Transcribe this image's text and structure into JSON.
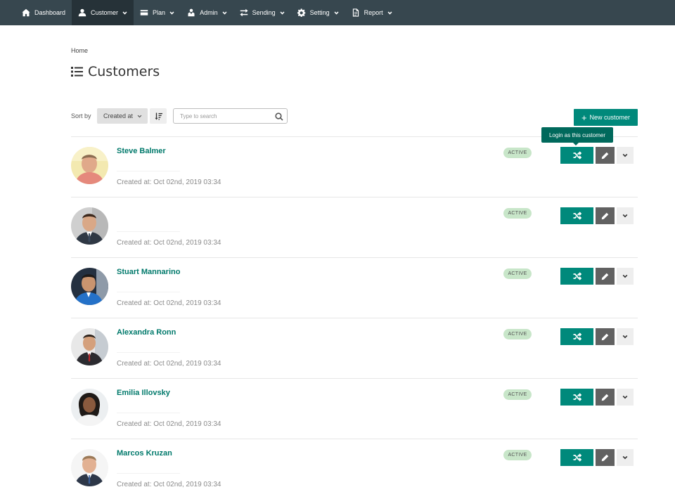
{
  "nav": {
    "items": [
      {
        "label": "Dashboard",
        "icon": "home-icon"
      },
      {
        "label": "Customer",
        "icon": "user-icon"
      },
      {
        "label": "Plan",
        "icon": "credit-card-icon"
      },
      {
        "label": "Admin",
        "icon": "admin-user-icon"
      },
      {
        "label": "Sending",
        "icon": "exchange-icon"
      },
      {
        "label": "Setting",
        "icon": "gear-icon"
      },
      {
        "label": "Report",
        "icon": "file-icon"
      }
    ],
    "active": "Customer"
  },
  "breadcrumb": "Home",
  "page": {
    "title": "Customers",
    "title_icon": "list-icon"
  },
  "toolbar": {
    "sort_label": "Sort by",
    "sort_value": "Created at",
    "search_placeholder": "Type to search",
    "new_button_label": "New customer"
  },
  "tooltip": "Login as this customer",
  "customers": [
    {
      "name": "Steve Balmer",
      "created": "Created at: Oct 02nd, 2019 03:34",
      "status": "ACTIVE"
    },
    {
      "name": "",
      "created": "Created at: Oct 02nd, 2019 03:34",
      "status": "ACTIVE"
    },
    {
      "name": "Stuart Mannarino",
      "created": "Created at: Oct 02nd, 2019 03:34",
      "status": "ACTIVE"
    },
    {
      "name": "Alexandra Ronn",
      "created": "Created at: Oct 02nd, 2019 03:34",
      "status": "ACTIVE"
    },
    {
      "name": "Emilia Illovsky",
      "created": "Created at: Oct 02nd, 2019 03:34",
      "status": "ACTIVE"
    },
    {
      "name": "Marcos Kruzan",
      "created": "Created at: Oct 02nd, 2019 03:34",
      "status": "ACTIVE"
    }
  ],
  "colors": {
    "navbar": "#37474f",
    "navbar_active": "#263238",
    "accent": "#00897b",
    "link": "#00796b",
    "status_bg": "#c8e6c9",
    "edit_button": "#616161"
  }
}
